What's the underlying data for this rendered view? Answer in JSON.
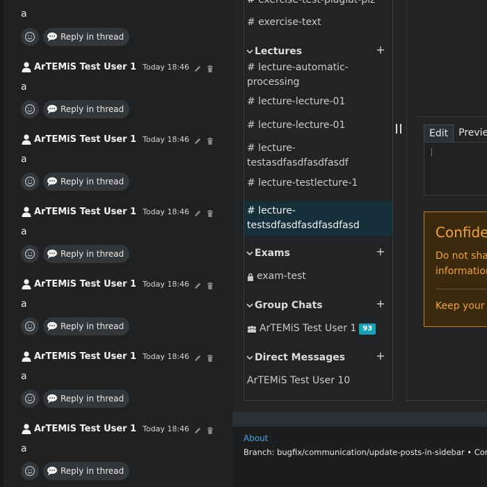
{
  "thread": {
    "first_text": "a",
    "reply_label": "Reply in thread",
    "messages": [
      {
        "author": "ArTEMiS Test User 1",
        "time": "Today 18:46",
        "text": "a"
      },
      {
        "author": "ArTEMiS Test User 1",
        "time": "Today 18:46",
        "text": "a"
      },
      {
        "author": "ArTEMiS Test User 1",
        "time": "Today 18:46",
        "text": "a"
      },
      {
        "author": "ArTEMiS Test User 1",
        "time": "Today 18:46",
        "text": "a"
      },
      {
        "author": "ArTEMiS Test User 1",
        "time": "Today 18:46",
        "text": "a"
      },
      {
        "author": "ArTEMiS Test User 1",
        "time": "Today 18:46",
        "text": "a"
      }
    ]
  },
  "sidebar": {
    "exercises_partial": "# exercise-test-plagiat-plz",
    "exercise_text": "# exercise-text",
    "sections": {
      "lectures": "Lectures",
      "exams": "Exams",
      "group_chats": "Group Chats",
      "direct_messages": "Direct Messages"
    },
    "lectures": [
      "# lecture-automatic-processing",
      "# lecture-lecture-01",
      "# lecture-lecture-01",
      "# lecture-testasdfasdfasdfasdf",
      "# lecture-testlecture-1",
      "# lecture-testsdfasdfasdfasdfasd"
    ],
    "exams": [
      "exam-test"
    ],
    "group_chats": [
      {
        "name": "ArTEMiS Test User 1",
        "badge": "93"
      }
    ],
    "direct_messages": [
      "ArTEMiS Test User 10"
    ],
    "add_symbol": "+"
  },
  "editor": {
    "tabs": [
      "Edit",
      "Preview"
    ],
    "active_tab": "Edit"
  },
  "confidential": {
    "title": "Confidential",
    "line1": "Do not share",
    "line2": "information",
    "footer": "Keep your p"
  },
  "footer": {
    "about": "About",
    "branch": "Branch: bugfix/communication/update-posts-in-sidebar • Comm"
  },
  "colors": {
    "accent": "#17a2b8",
    "warning": "#f0a33a",
    "link": "#4aa3df",
    "active_bg": "#15303a"
  }
}
